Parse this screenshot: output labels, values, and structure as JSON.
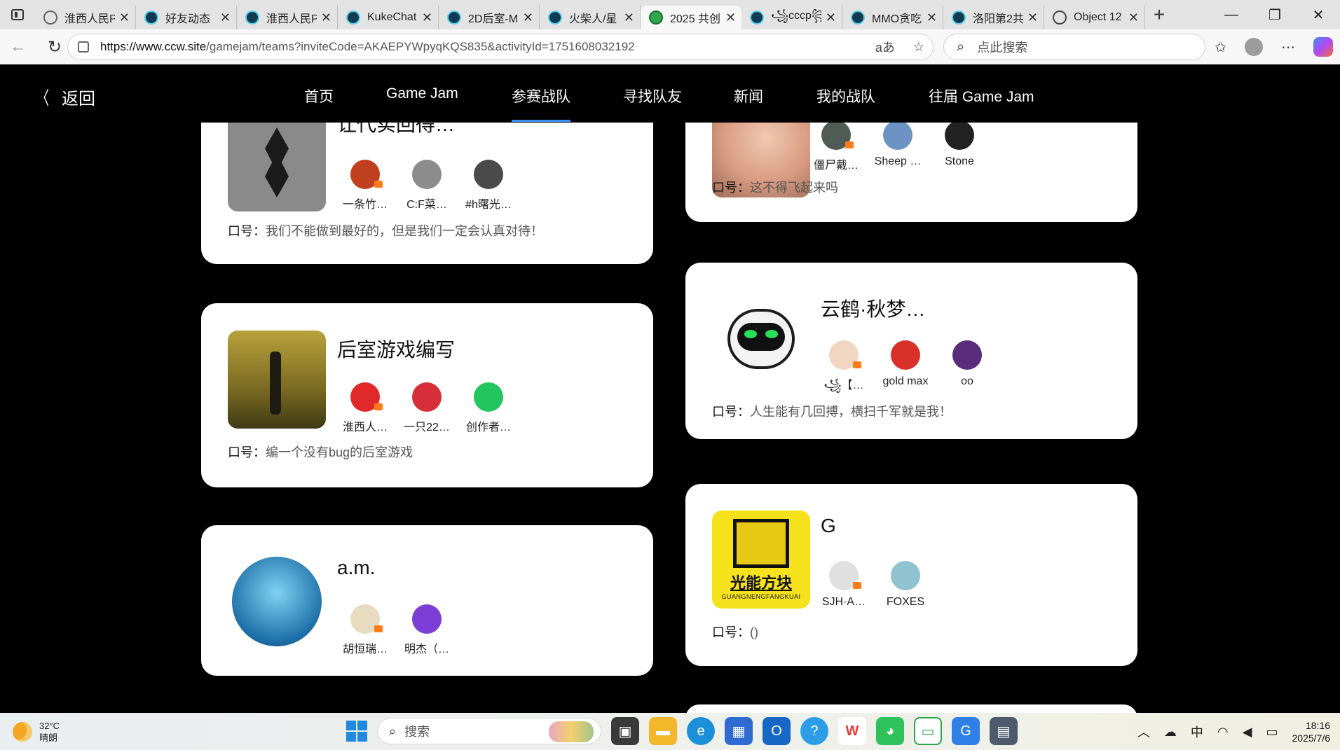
{
  "browser": {
    "tabs": [
      {
        "title": "淮西人民P",
        "favicon": "globe",
        "active": false
      },
      {
        "title": "好友动态",
        "favicon": "ccw",
        "active": false
      },
      {
        "title": "淮西人民P",
        "favicon": "ccw",
        "active": false
      },
      {
        "title": "KukeChat",
        "favicon": "ccw",
        "active": false
      },
      {
        "title": "2D后室-M",
        "favicon": "ccw",
        "active": false
      },
      {
        "title": "火柴人/星",
        "favicon": "ccw",
        "active": false
      },
      {
        "title": "2025 共创",
        "favicon": "green",
        "active": true
      },
      {
        "title": "꧁cccp꧂",
        "favicon": "ccw",
        "active": false
      },
      {
        "title": "MMO贪吃",
        "favicon": "ccw",
        "active": false
      },
      {
        "title": "洛阳第2共",
        "favicon": "ccw",
        "active": false
      },
      {
        "title": "Object 12",
        "favicon": "obj",
        "active": false
      }
    ],
    "new_tab": "+",
    "url_host": "https://www.ccw.site",
    "url_path": "/gamejam/teams?inviteCode=AKAEPYWpyqKQS835&activityId=1751608032192",
    "read_aloud": "aあ",
    "search_placeholder": "点此搜索"
  },
  "site": {
    "back_label": "返回",
    "nav": [
      "首页",
      "Game Jam",
      "参赛战队",
      "寻找队友",
      "新闻",
      "我的战队",
      "往届 Game Jam"
    ],
    "active_nav": "参赛战队",
    "slogan_label": "口号："
  },
  "teams": [
    {
      "name": "让代实回得…",
      "logo": "pixel-sword",
      "members": [
        {
          "name": "一条竹…",
          "avatar_color": "#c0401f",
          "leader": true
        },
        {
          "name": "C:F菜…",
          "avatar_color": "#8c8c8c",
          "leader": false
        },
        {
          "name": "#h曙光…",
          "avatar_color": "#4a4a4a",
          "leader": false
        }
      ],
      "slogan": "我们不能做到最好的，但是我们一定会认真对待！"
    },
    {
      "name": "后室游戏编写",
      "logo": "backrooms",
      "members": [
        {
          "name": "淮西人…",
          "avatar_color": "#e02a2a",
          "leader": true
        },
        {
          "name": "一只22…",
          "avatar_color": "#d62f3a",
          "leader": false
        },
        {
          "name": "创作者…",
          "avatar_color": "#22c55e",
          "leader": false
        }
      ],
      "slogan": "编一个没有bug的后室游戏"
    },
    {
      "name": "a.m.",
      "logo": "ocean-globe",
      "members": [
        {
          "name": "胡恒瑞…",
          "avatar_color": "#e8dcc0",
          "leader": true
        },
        {
          "name": "明杰（…",
          "avatar_color": "#7b3fd6",
          "leader": false
        }
      ],
      "slogan": ""
    },
    {
      "name": "",
      "logo": "face-photo",
      "members": [
        {
          "name": "僵尸戴…",
          "avatar_color": "#4f5b54",
          "leader": true
        },
        {
          "name": "Sheep …",
          "avatar_color": "#6d93c4",
          "leader": false
        },
        {
          "name": "Stone",
          "avatar_color": "#222222",
          "leader": false
        }
      ],
      "slogan": "这不得飞起来吗"
    },
    {
      "name": "云鹤·秋梦…",
      "logo": "robot",
      "members": [
        {
          "name": "꧁【…",
          "avatar_color": "#f1d7c1",
          "leader": true
        },
        {
          "name": "gold max",
          "avatar_color": "#d9302a",
          "leader": false
        },
        {
          "name": "oo",
          "avatar_color": "#5a2c7c",
          "leader": false
        }
      ],
      "slogan": "人生能有几回搏，横扫千军就是我！"
    },
    {
      "name": "G",
      "logo": "guangneng",
      "logo_text": "光能方块",
      "logo_subtext": "GUANGNENGFANGKUAI",
      "members": [
        {
          "name": "SJH·A…",
          "avatar_color": "#e0e0e0",
          "leader": true
        },
        {
          "name": "FOXES",
          "avatar_color": "#8fc3cf",
          "leader": false
        }
      ],
      "slogan": "()"
    }
  ],
  "taskbar": {
    "temp": "32°C",
    "weather": "晴朗",
    "search": "搜索",
    "ime": "中",
    "time": "18:16",
    "date": "2025/7/6"
  },
  "colors": {
    "accent": "#3a8ef6",
    "page_bg": "#000000",
    "card_bg": "#ffffff"
  }
}
